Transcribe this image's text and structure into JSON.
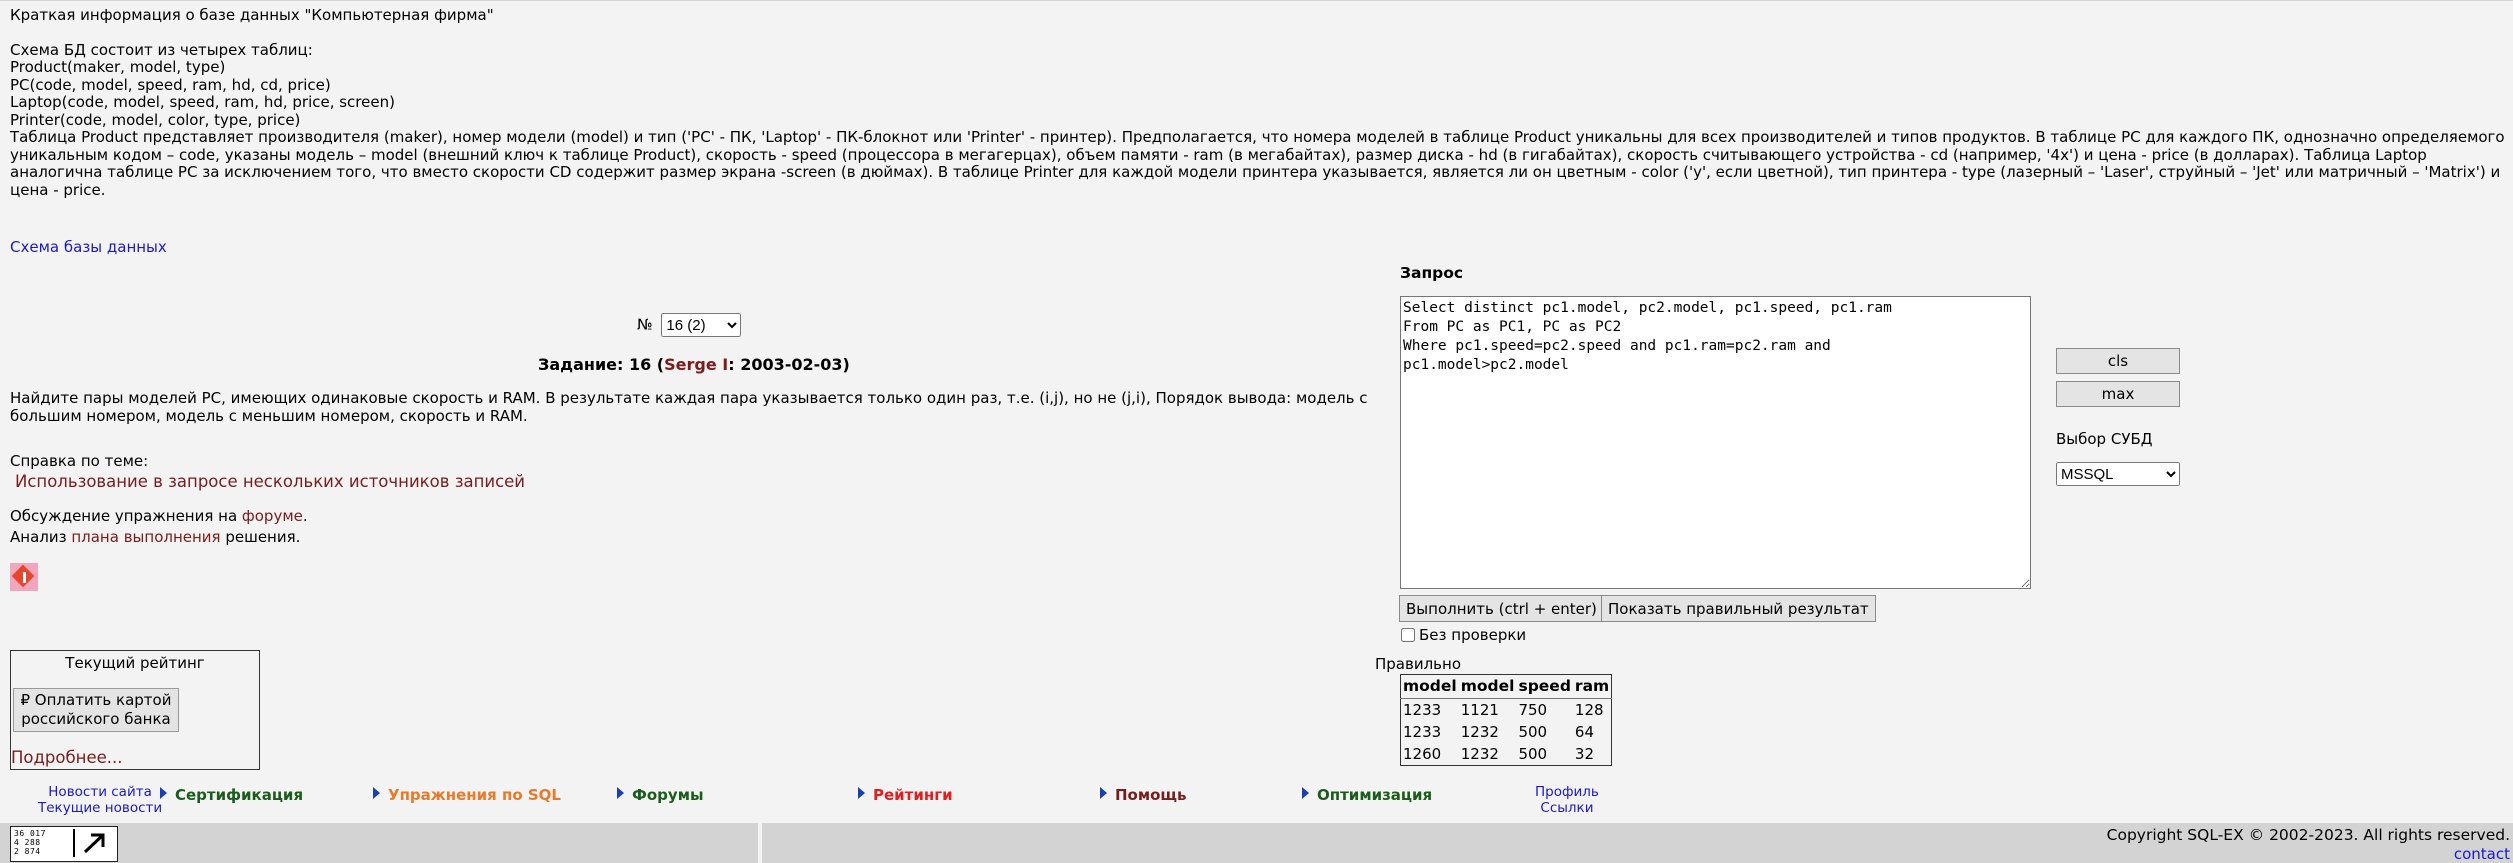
{
  "db_info": {
    "title": "Краткая информация о базе данных \"Компьютерная фирма\"",
    "schema_intro": "Схема БД состоит из четырех таблиц:",
    "tables": [
      "Product(maker, model, type)",
      "PC(code, model, speed, ram, hd, cd, price)",
      "Laptop(code, model, speed, ram, hd, price, screen)",
      "Printer(code, model, color, type, price)"
    ],
    "description": "Таблица Product представляет производителя (maker), номер модели (model) и тип ('PC' - ПК, 'Laptop' - ПК-блокнот или 'Printer' - принтер). Предполагается, что номера моделей в таблице Product уникальны для всех производителей и типов продуктов. В таблице PC для каждого ПК, однозначно определяемого уникальным кодом – code, указаны модель – model (внешний ключ к таблице Product), скорость - speed (процессора в мегагерцах), объем памяти - ram (в мегабайтах), размер диска - hd (в гигабайтах), скорость считывающего устройства - cd (например, '4x') и цена - price (в долларах). Таблица Laptop аналогична таблице PC за исключением того, что вместо скорости CD содержит размер экрана -screen (в дюймах). В таблице Printer для каждой модели принтера указывается, является ли он цветным - color ('y', если цветной), тип принтера - type (лазерный – 'Laser', струйный – 'Jet' или матричный – 'Matrix') и цена - price."
  },
  "schema_link": "Схема базы данных",
  "task": {
    "number_label": "№",
    "selected_task": "16 (2)",
    "title_prefix": "Задание: 16 (",
    "author": "Serge I",
    "title_suffix": ": 2003-02-03)",
    "text": "Найдите пары моделей PC, имеющих одинаковые скорость и RAM. В результате каждая пара указывается только один раз, т.е. (i,j), но не (j,i), Порядок вывода: модель с большим номером, модель с меньшим номером, скорость и RAM.",
    "help_title": "Справка по теме:",
    "help_link": "Использование в запросе нескольких источников записей",
    "forum_prefix": "Обсуждение упражнения на ",
    "forum_link": "форуме",
    "forum_suffix": ".",
    "plan_prefix": "Анализ ",
    "plan_link": "плана выполнения",
    "plan_suffix": " решения."
  },
  "rating": {
    "title": "Текущий рейтинг",
    "pay_button": "₽ Оплатить картой российского банка",
    "details_link": "Подробнее..."
  },
  "nav": {
    "news_site": "Новости сайта",
    "news_current": "Текущие новости",
    "certification": "Сертификация",
    "sql_exercises": "Упражнения по SQL",
    "forums": "Форумы",
    "ratings": "Рейтинги",
    "help": "Помощь",
    "optimization": "Оптимизация",
    "profile": "Профиль",
    "links": "Ссылки"
  },
  "query": {
    "label": "Запрос",
    "text": "Select distinct pc1.model, pc2.model, pc1.speed, pc1.ram\nFrom PC as PC1, PC as PC2\nWhere pc1.speed=pc2.speed and pc1.ram=pc2.ram and\npc1.model>pc2.model",
    "run_button": "Выполнить (ctrl + enter)",
    "show_button": "Показать правильный результат",
    "nocheck_label": "Без проверки",
    "correct_label": "Правильно"
  },
  "tools": {
    "cls_button": "cls",
    "max_button": "max",
    "dbms_label": "Выбор СУБД",
    "dbms_selected": "MSSQL"
  },
  "result": {
    "headers": [
      "model",
      "model",
      "speed",
      "ram"
    ],
    "rows": [
      [
        "1233",
        "1121",
        "750",
        "128"
      ],
      [
        "1233",
        "1232",
        "500",
        "64"
      ],
      [
        "1260",
        "1232",
        "500",
        "32"
      ]
    ]
  },
  "counter": {
    "lines": [
      "36 017",
      "4 288",
      "2 874"
    ]
  },
  "footer": {
    "copyright": "Copyright SQL-EX © 2002-2023. All rights reserved.",
    "contact": "contact"
  },
  "colors": {
    "background": "#f3f3f3",
    "link_blue": "#1a1acc",
    "maroon": "#7a1c1c",
    "nav_green": "#1a5c1a",
    "nav_orange": "#e87a2a",
    "nav_red": "#e02020",
    "footer_gray": "#d3d3d3"
  }
}
